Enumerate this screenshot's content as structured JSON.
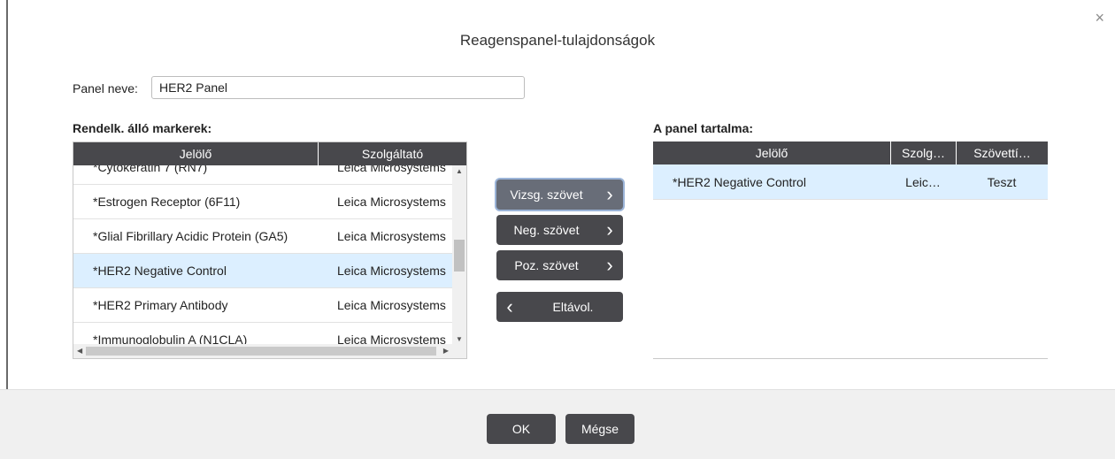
{
  "dialog": {
    "title": "Reagenspanel-tulajdonságok",
    "close_glyph": "×"
  },
  "panel_name": {
    "label": "Panel neve:",
    "value": "HER2 Panel"
  },
  "available": {
    "label": "Rendelk. álló markerek:",
    "columns": [
      "Jelölő",
      "Szolgáltató"
    ],
    "rows": [
      {
        "marker": "*Cytokeratin 7 (RN7)",
        "supplier": "Leica Microsystems"
      },
      {
        "marker": "*Estrogen Receptor (6F11)",
        "supplier": "Leica Microsystems"
      },
      {
        "marker": "*Glial Fibrillary Acidic Protein (GA5)",
        "supplier": "Leica Microsystems"
      },
      {
        "marker": "*HER2 Negative Control",
        "supplier": "Leica Microsystems"
      },
      {
        "marker": "*HER2 Primary Antibody",
        "supplier": "Leica Microsystems"
      },
      {
        "marker": "*Immunoglobulin A (N1CLA)",
        "supplier": "Leica Microsystems"
      }
    ],
    "selected_row": 3
  },
  "actions": {
    "test_tissue": "Vizsg. szövet",
    "neg_tissue": "Neg. szövet",
    "pos_tissue": "Poz. szövet",
    "remove": "Eltávol."
  },
  "contents": {
    "label": "A panel tartalma:",
    "columns": [
      "Jelölő",
      "Szolg…",
      "Szövettí…"
    ],
    "rows": [
      {
        "marker": "*HER2 Negative Control",
        "supplier": "Leic…",
        "tissue": "Teszt"
      }
    ]
  },
  "footer": {
    "ok": "OK",
    "cancel": "Mégse"
  },
  "colors": {
    "header_bg": "#48484c",
    "selected_row": "#dcefff",
    "button_bg": "#48484c",
    "footer_bg": "#f0f0f0"
  },
  "icons": {
    "close": "close-icon",
    "chevron_right": "chevron-right-icon",
    "chevron_left": "chevron-left-icon"
  }
}
